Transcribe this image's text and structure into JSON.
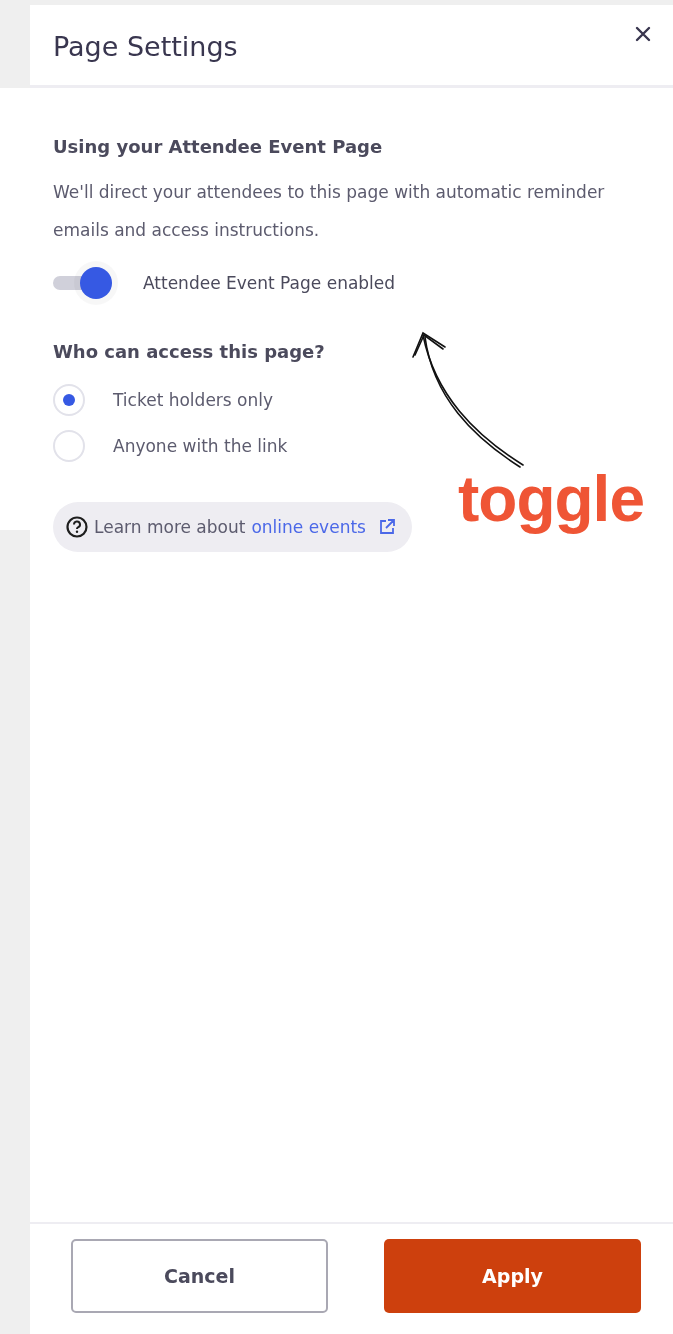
{
  "dialog": {
    "title": "Page Settings"
  },
  "section": {
    "heading": "Using your Attendee Event Page",
    "description": "We'll direct your attendees to this page with automatic reminder emails and access instructions."
  },
  "toggle": {
    "label": "Attendee Event Page enabled",
    "on": true
  },
  "access": {
    "heading": "Who can access this page?",
    "options": [
      {
        "label": "Ticket holders only",
        "selected": true
      },
      {
        "label": "Anyone with the link",
        "selected": false
      }
    ]
  },
  "help": {
    "text": "Learn more about",
    "link": "online events"
  },
  "buttons": [
    {
      "label": "Cancel",
      "kind": "secondary"
    },
    {
      "label": "Apply",
      "kind": "primary"
    }
  ],
  "annotation": {
    "text": "toggle"
  }
}
